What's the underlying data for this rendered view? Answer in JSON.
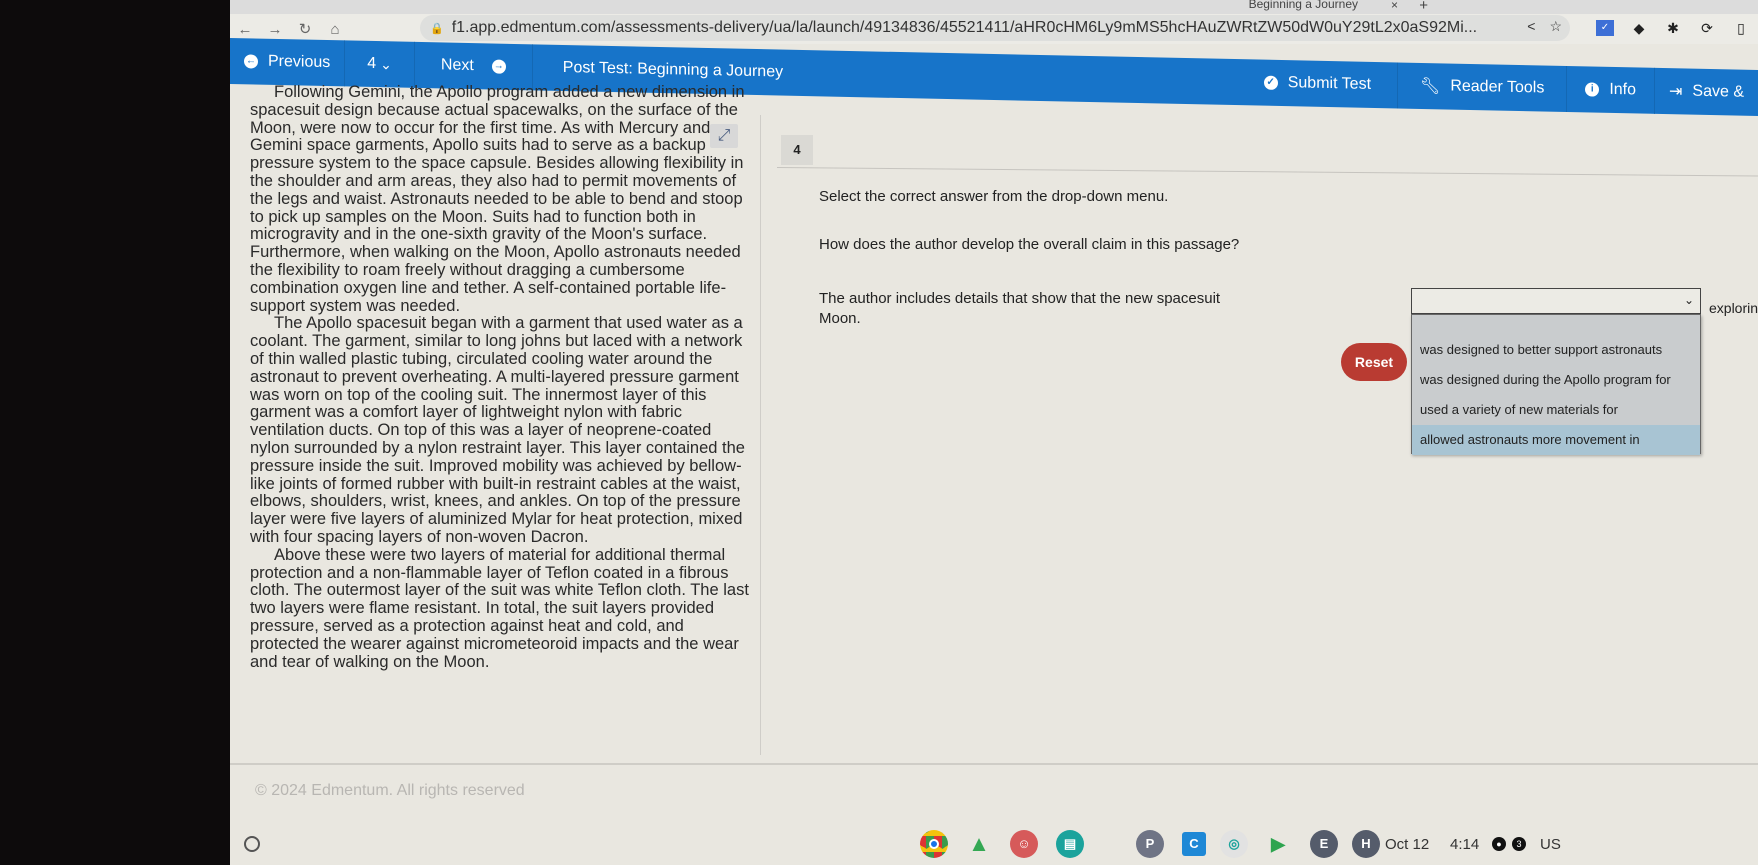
{
  "browser": {
    "tab_title": "Beginning a Journey",
    "tab_close": "×",
    "new_tab": "+",
    "url": "f1.app.edmentum.com/assessments-delivery/ua/la/launch/49134836/45521411/aHR0cHM6Ly9mMS5hcHAuZWRtZW50dW0uY29tL2x0aS92Mi...",
    "nav": {
      "back": "←",
      "forward": "→",
      "reload": "↻",
      "home": "⌂"
    },
    "lock_icon": "🔒",
    "share_icon": "<",
    "star_icon": "☆",
    "extensions": [
      "✓",
      "◆",
      "✱",
      "⟳",
      "▯"
    ]
  },
  "header": {
    "previous_label": "Previous",
    "question_number": "4",
    "next_label": "Next",
    "test_title": "Post Test: Beginning a Journey",
    "submit_label": "Submit Test",
    "reader_tools_label": "Reader Tools",
    "info_label": "Info",
    "save_label": "Save &"
  },
  "passage": {
    "expand_icon": "⤢",
    "paragraphs": [
      "Following Gemini, the Apollo program added a new dimension in spacesuit design because actual spacewalks, on the surface of the Moon, were now to occur for the first time. As with Mercury and Gemini space garments, Apollo suits had to serve as a backup pressure system to the space capsule. Besides allowing flexibility in the shoulder and arm areas, they also had to permit movements of the legs and waist. Astronauts needed to be able to bend and stoop to pick up samples on the Moon. Suits had to function both in microgravity and in the one-sixth gravity of the Moon's surface. Furthermore, when walking on the Moon, Apollo astronauts needed the flexibility to roam freely without dragging a cumbersome combination oxygen line and tether. A self-contained portable life-support system was needed.",
      "The Apollo spacesuit began with a garment that used water as a coolant. The garment, similar to long johns but laced with a network of thin walled plastic tubing, circulated cooling water around the astronaut to prevent overheating. A multi-layered pressure garment was worn on top of the cooling suit. The innermost layer of this garment was a comfort layer of lightweight nylon with fabric ventilation ducts. On top of this was a layer of neoprene-coated nylon surrounded by a nylon restraint layer. This layer contained the pressure inside the suit. Improved mobility was achieved by bellow-like joints of formed rubber with built-in restraint cables at the waist, elbows, shoulders, wrist, knees, and ankles. On top of the pressure layer were five layers of aluminized Mylar for heat protection, mixed with four spacing layers of non-woven Dacron.",
      "Above these were two layers of material for additional thermal protection and a non-flammable layer of Teflon coated in a fibrous cloth. The outermost layer of the suit was white Teflon cloth. The last two layers were flame resistant. In total, the suit layers provided pressure, served as a protection against heat and cold, and protected the wearer against micrometeoroid impacts and the wear and tear of walking on the Moon."
    ]
  },
  "question": {
    "number": "4",
    "instruction": "Select the correct answer from the drop-down menu.",
    "prompt": "How does the author develop the overall claim in this passage?",
    "stem_before": "The author includes details that show that the new spacesuit",
    "stem_after": "exploring the",
    "stem_end": "Moon.",
    "selected_value": "",
    "options": [
      "was designed to better support astronauts",
      "was designed during the Apollo program for",
      "used a variety of new materials for",
      "allowed astronauts more movement in"
    ],
    "highlighted_option_index": 3,
    "reset_label": "Reset"
  },
  "footer": {
    "copyright": "© 2024 Edmentum. All rights reserved"
  },
  "shelf": {
    "apps": [
      "Chrome",
      "Drive",
      "App",
      "Classroom",
      "P",
      "C",
      "Q",
      "Play Store",
      "E",
      "H"
    ],
    "app_letters": {
      "p": "P",
      "c": "C",
      "e": "E",
      "h": "H"
    },
    "date": "Oct 12",
    "time": "4:14",
    "notification_count": "3",
    "locale": "US"
  },
  "colors": {
    "header_blue": "#1774c9",
    "reset_red": "#b93b32",
    "dropdown_bg": "#c9ccce",
    "dropdown_highlight": "#a8c4d3"
  }
}
